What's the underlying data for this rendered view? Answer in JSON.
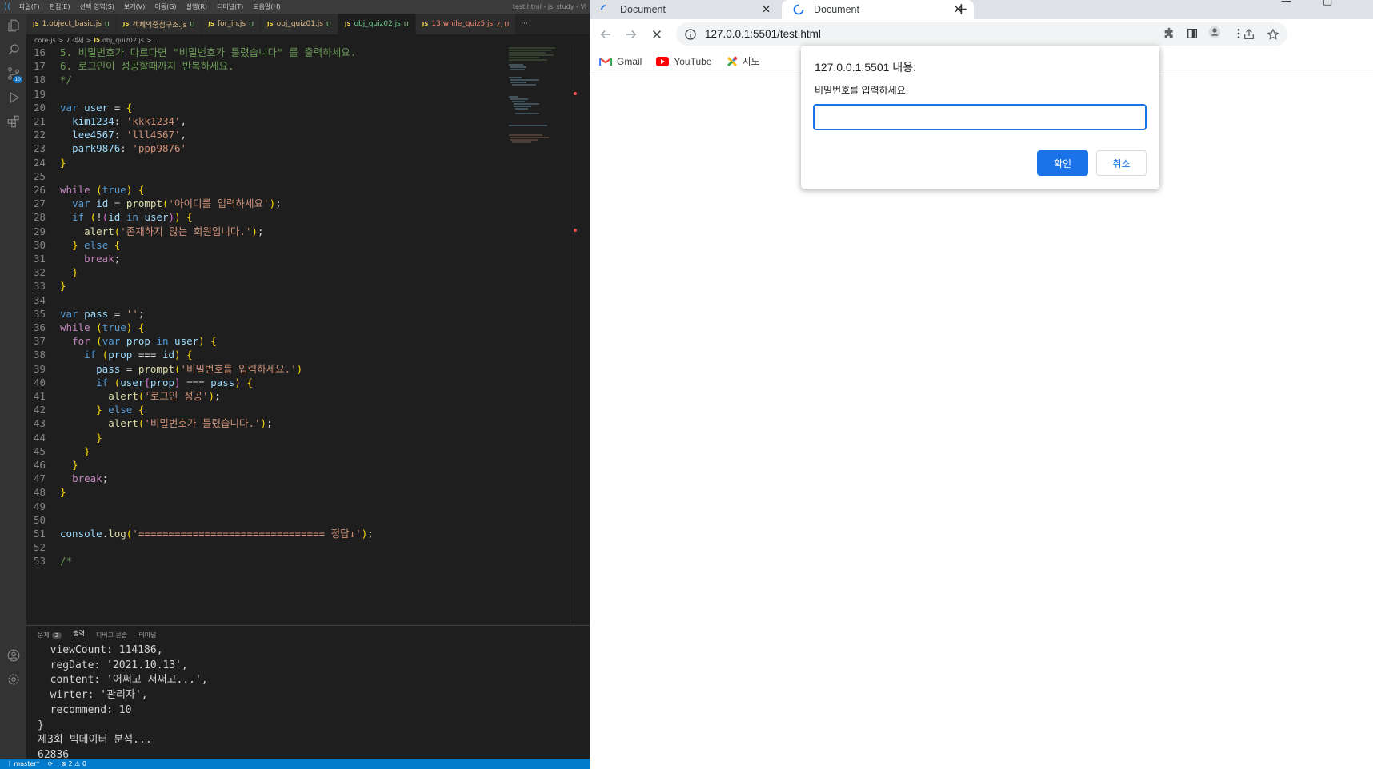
{
  "vscode": {
    "menu": [
      "파일(F)",
      "편집(E)",
      "선택 영역(S)",
      "보기(V)",
      "이동(G)",
      "실행(R)",
      "터미널(T)",
      "도움말(H)"
    ],
    "window_title": "test.html - js_study - Vi",
    "source_control_badge": "10",
    "tabs": [
      {
        "name": "1.object_basic.js",
        "marker": "U",
        "state": "modified"
      },
      {
        "name": "객체의중첩구조.js",
        "marker": "U",
        "state": "modified"
      },
      {
        "name": "for_in.js",
        "marker": "U",
        "state": "modified"
      },
      {
        "name": "obj_quiz01.js",
        "marker": "U",
        "state": "modified"
      },
      {
        "name": "obj_quiz02.js",
        "marker": "U",
        "state": "active"
      },
      {
        "name": "13.while_quiz5.js",
        "marker": "2, U",
        "state": "error"
      }
    ],
    "tabs_more": "···",
    "breadcrumb": [
      "core-js",
      ">",
      "7.객체",
      ">",
      "obj_quiz02.js",
      ">",
      "..."
    ],
    "code_lines": [
      {
        "n": "16",
        "t": "5. 비밀번호가 다르다면 \"비밀번호가 틀렸습니다\" 를 출력하세요."
      },
      {
        "n": "17",
        "t": "6. 로그인이 성공할때까지 반복하세요."
      },
      {
        "n": "18",
        "t": "*/"
      },
      {
        "n": "19",
        "t": ""
      },
      {
        "n": "20",
        "t": "var user = {"
      },
      {
        "n": "21",
        "t": "  kim1234: 'kkk1234',"
      },
      {
        "n": "22",
        "t": "  lee4567: 'lll4567',"
      },
      {
        "n": "23",
        "t": "  park9876: 'ppp9876'"
      },
      {
        "n": "24",
        "t": "}"
      },
      {
        "n": "25",
        "t": ""
      },
      {
        "n": "26",
        "t": "while (true) {"
      },
      {
        "n": "27",
        "t": "  var id = prompt('아이디를 입력하세요');"
      },
      {
        "n": "28",
        "t": "  if (!(id in user)) {"
      },
      {
        "n": "29",
        "t": "    alert('존재하지 않는 회원입니다.');"
      },
      {
        "n": "30",
        "t": "  } else {"
      },
      {
        "n": "31",
        "t": "    break;"
      },
      {
        "n": "32",
        "t": "  }"
      },
      {
        "n": "33",
        "t": "}"
      },
      {
        "n": "34",
        "t": ""
      },
      {
        "n": "35",
        "t": "var pass = '';"
      },
      {
        "n": "36",
        "t": "while (true) {"
      },
      {
        "n": "37",
        "t": "  for (var prop in user) {"
      },
      {
        "n": "38",
        "t": "    if (prop === id) {"
      },
      {
        "n": "39",
        "t": "      pass = prompt('비밀번호를 입력하세요.')"
      },
      {
        "n": "40",
        "t": "      if (user[prop] === pass) {"
      },
      {
        "n": "41",
        "t": "        alert('로그인 성공');"
      },
      {
        "n": "42",
        "t": "      } else {"
      },
      {
        "n": "43",
        "t": "        alert('비밀번호가 틀렸습니다.');"
      },
      {
        "n": "44",
        "t": "      }"
      },
      {
        "n": "45",
        "t": "    }"
      },
      {
        "n": "46",
        "t": "  }"
      },
      {
        "n": "47",
        "t": "  break;"
      },
      {
        "n": "48",
        "t": "}"
      },
      {
        "n": "49",
        "t": ""
      },
      {
        "n": "50",
        "t": ""
      },
      {
        "n": "51",
        "t": "console.log('=============================== 정답↓');"
      },
      {
        "n": "52",
        "t": ""
      },
      {
        "n": "53",
        "t": "/*"
      }
    ],
    "panel_tabs": [
      {
        "label": "문제",
        "count": "2"
      },
      {
        "label": "출력",
        "active": true
      },
      {
        "label": "디버그 콘솔"
      },
      {
        "label": "터미널"
      }
    ],
    "output_lines": [
      "  viewCount: 114186,",
      "  regDate: '2021.10.13',",
      "  content: '어쩌고 저쩌고...',",
      "  wirter: '관리자',",
      "  recommend: 10",
      "}",
      "제3회 빅데이터 분석...",
      "62836"
    ],
    "status": {
      "branch": "master*",
      "sync": "⟳",
      "problems": "⊗ 2 ⚠ 0"
    }
  },
  "chrome": {
    "tabs": [
      {
        "title": "Document",
        "close": "✕"
      },
      {
        "title": "Document",
        "close": "✕",
        "active": true
      }
    ],
    "new_tab": "+",
    "url": "127.0.0.1:5501/test.html",
    "bookmarks": [
      {
        "label": "Gmail",
        "icon": "gmail-icon"
      },
      {
        "label": "YouTube",
        "icon": "youtube-icon"
      },
      {
        "label": "지도",
        "icon": "maps-icon"
      }
    ],
    "dialog": {
      "title": "127.0.0.1:5501 내용:",
      "message": "비밀번호를 입력하세요.",
      "input_value": "",
      "ok_label": "확인",
      "cancel_label": "취소"
    }
  },
  "colors": {
    "vscode_accent": "#007acc",
    "chrome_accent": "#1a73e8",
    "editor_bg": "#1e1e1e"
  }
}
